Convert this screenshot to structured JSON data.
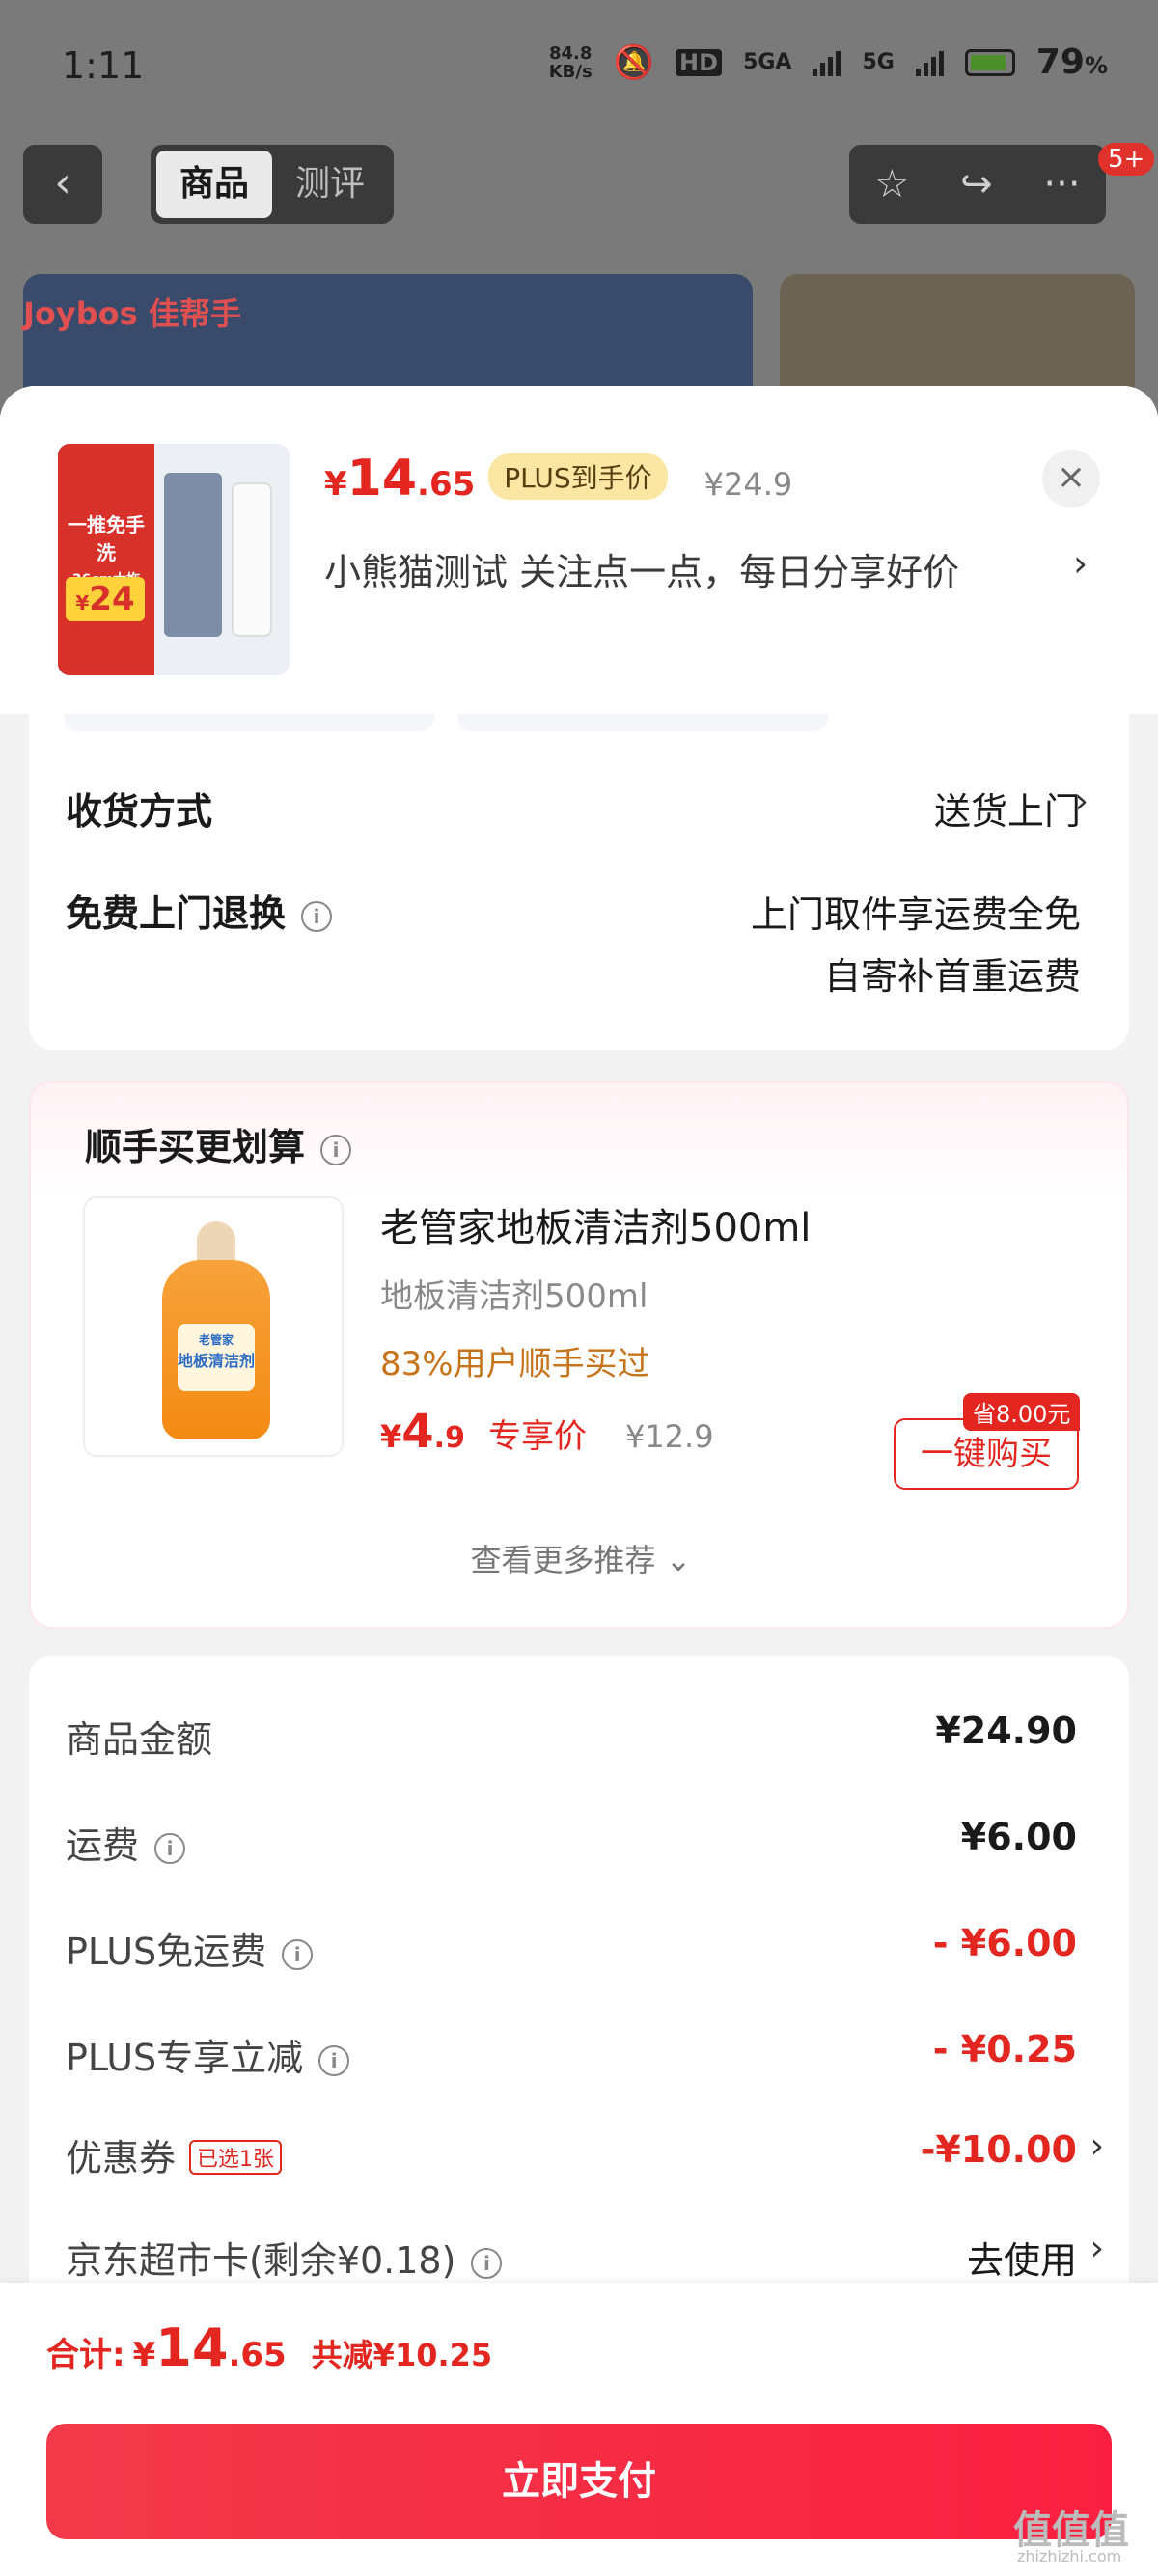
{
  "status_bar": {
    "time": "1:11",
    "net_speed": "84.8",
    "net_unit": "KB/s",
    "sim1": "5GA",
    "sim2": "5G",
    "battery": "79",
    "battery_unit": "%",
    "battery_color": "#4a8f2a"
  },
  "top_nav": {
    "back_icon": "chevron-left-icon",
    "tabs": [
      {
        "label": "商品",
        "active": true
      },
      {
        "label": "测评",
        "active": false
      }
    ],
    "actions": [
      "star-icon",
      "share-icon",
      "more-icon"
    ],
    "badge": "5+",
    "brand_logo": "Joybos 佳帮手"
  },
  "product_header": {
    "thumb_text": "一推免手洗",
    "thumb_sub": "36cm大拖头",
    "thumb_price_sym": "¥",
    "thumb_price": "24",
    "price_symbol": "¥",
    "price_int": "14",
    "price_dec": ".65",
    "plus_tag": "PLUS到手价",
    "original_price": "¥24.9",
    "subtitle": "小熊猫测试  关注点一点，每日分享好价",
    "chevron": "›",
    "close": "×"
  },
  "delivery": {
    "method_label": "收货方式",
    "method_value": "送货上门",
    "return_label": "免费上门退换",
    "return_line1": "上门取件享运费全免",
    "return_line2": "自寄补首重运费"
  },
  "recommend": {
    "title": "顺手买更划算",
    "item": {
      "name": "老管家地板清洁剂500ml",
      "sub": "地板清洁剂500ml",
      "users": "83%用户顺手买过",
      "price_sym": "¥",
      "price_int": "4",
      "price_dec": ".9",
      "price_tag": "专享价",
      "orig_price": "¥12.9",
      "save_tag": "省8.00元",
      "buy_label": "一键购买",
      "label_text": "地板清洁剂",
      "brand": "老管家"
    },
    "more": "查看更多推荐 ⌄"
  },
  "totals": {
    "rows": [
      {
        "label": "商品金额",
        "value": "¥24.90"
      },
      {
        "label": "运费",
        "value": "¥6.00"
      },
      {
        "label": "PLUS免运费",
        "value": "- ¥6.00"
      },
      {
        "label": "PLUS专享立减",
        "value": "- ¥0.25"
      },
      {
        "label": "优惠券",
        "value": "-¥10.00",
        "tag": "已选1张"
      },
      {
        "label": "京东超市卡(剩余¥0.18)",
        "value": "去使用"
      }
    ]
  },
  "bottom": {
    "sum_label": "合计:",
    "sum_sym": "¥",
    "sum_int": "14",
    "sum_dec": ".65",
    "sum_reduce": "共减¥10.25",
    "pay_label": "立即支付"
  },
  "watermark": {
    "text": "值值值",
    "sub": "zhizhizhi.com"
  },
  "colors": {
    "accent_red": "#e3261f",
    "pay_gradient_start": "#f23a4a",
    "pay_gradient_end": "#fa1f40",
    "plus_tag_bg": "#fbe6a4",
    "users_orange": "#c7731a"
  }
}
